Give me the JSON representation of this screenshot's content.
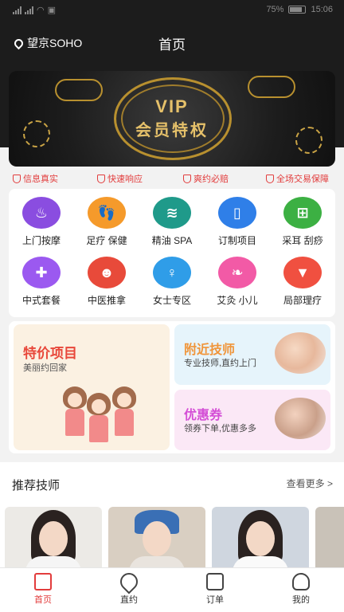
{
  "status": {
    "battery": "75%",
    "time": "15:06"
  },
  "header": {
    "location": "望京SOHO",
    "title": "首页"
  },
  "banner": {
    "vip": "VIP",
    "text": "会员特权"
  },
  "guarantees": [
    "信息真实",
    "快速响应",
    "爽约必赔",
    "全场交易保障"
  ],
  "categories": [
    {
      "label": "上门按摩",
      "icon": "massage-icon",
      "color": "#8a4de0"
    },
    {
      "label": "足疗 保健",
      "icon": "footprint-icon",
      "color": "#f59a2b"
    },
    {
      "label": "精油 SPA",
      "icon": "spa-stones-icon",
      "color": "#1f9a8a"
    },
    {
      "label": "订制项目",
      "icon": "phone-icon",
      "color": "#2f7fe8"
    },
    {
      "label": "采耳 刮痧",
      "icon": "grid-plus-icon",
      "color": "#3cb043"
    },
    {
      "label": "中式套餐",
      "icon": "gift-icon",
      "color": "#9b59f0"
    },
    {
      "label": "中医推拿",
      "icon": "doctor-icon",
      "color": "#e84a3a"
    },
    {
      "label": "女士专区",
      "icon": "swimsuit-icon",
      "color": "#2f9de8"
    },
    {
      "label": "艾灸 小儿",
      "icon": "feather-icon",
      "color": "#f25aa6"
    },
    {
      "label": "局部理疗",
      "icon": "tie-icon",
      "color": "#f05040"
    }
  ],
  "promo": {
    "deal": {
      "title": "特价项目",
      "sub": "美丽约回家"
    },
    "nearby": {
      "title": "附近技师",
      "sub": "专业技师,直约上门",
      "color": "#f0953a"
    },
    "coupon": {
      "title": "优惠券",
      "sub": "领券下单,优惠多多",
      "color": "#d44fd6"
    }
  },
  "recommend": {
    "title": "推荐技师",
    "more": "查看更多 >"
  },
  "tabs": [
    "首页",
    "直约",
    "订单",
    "我的"
  ]
}
